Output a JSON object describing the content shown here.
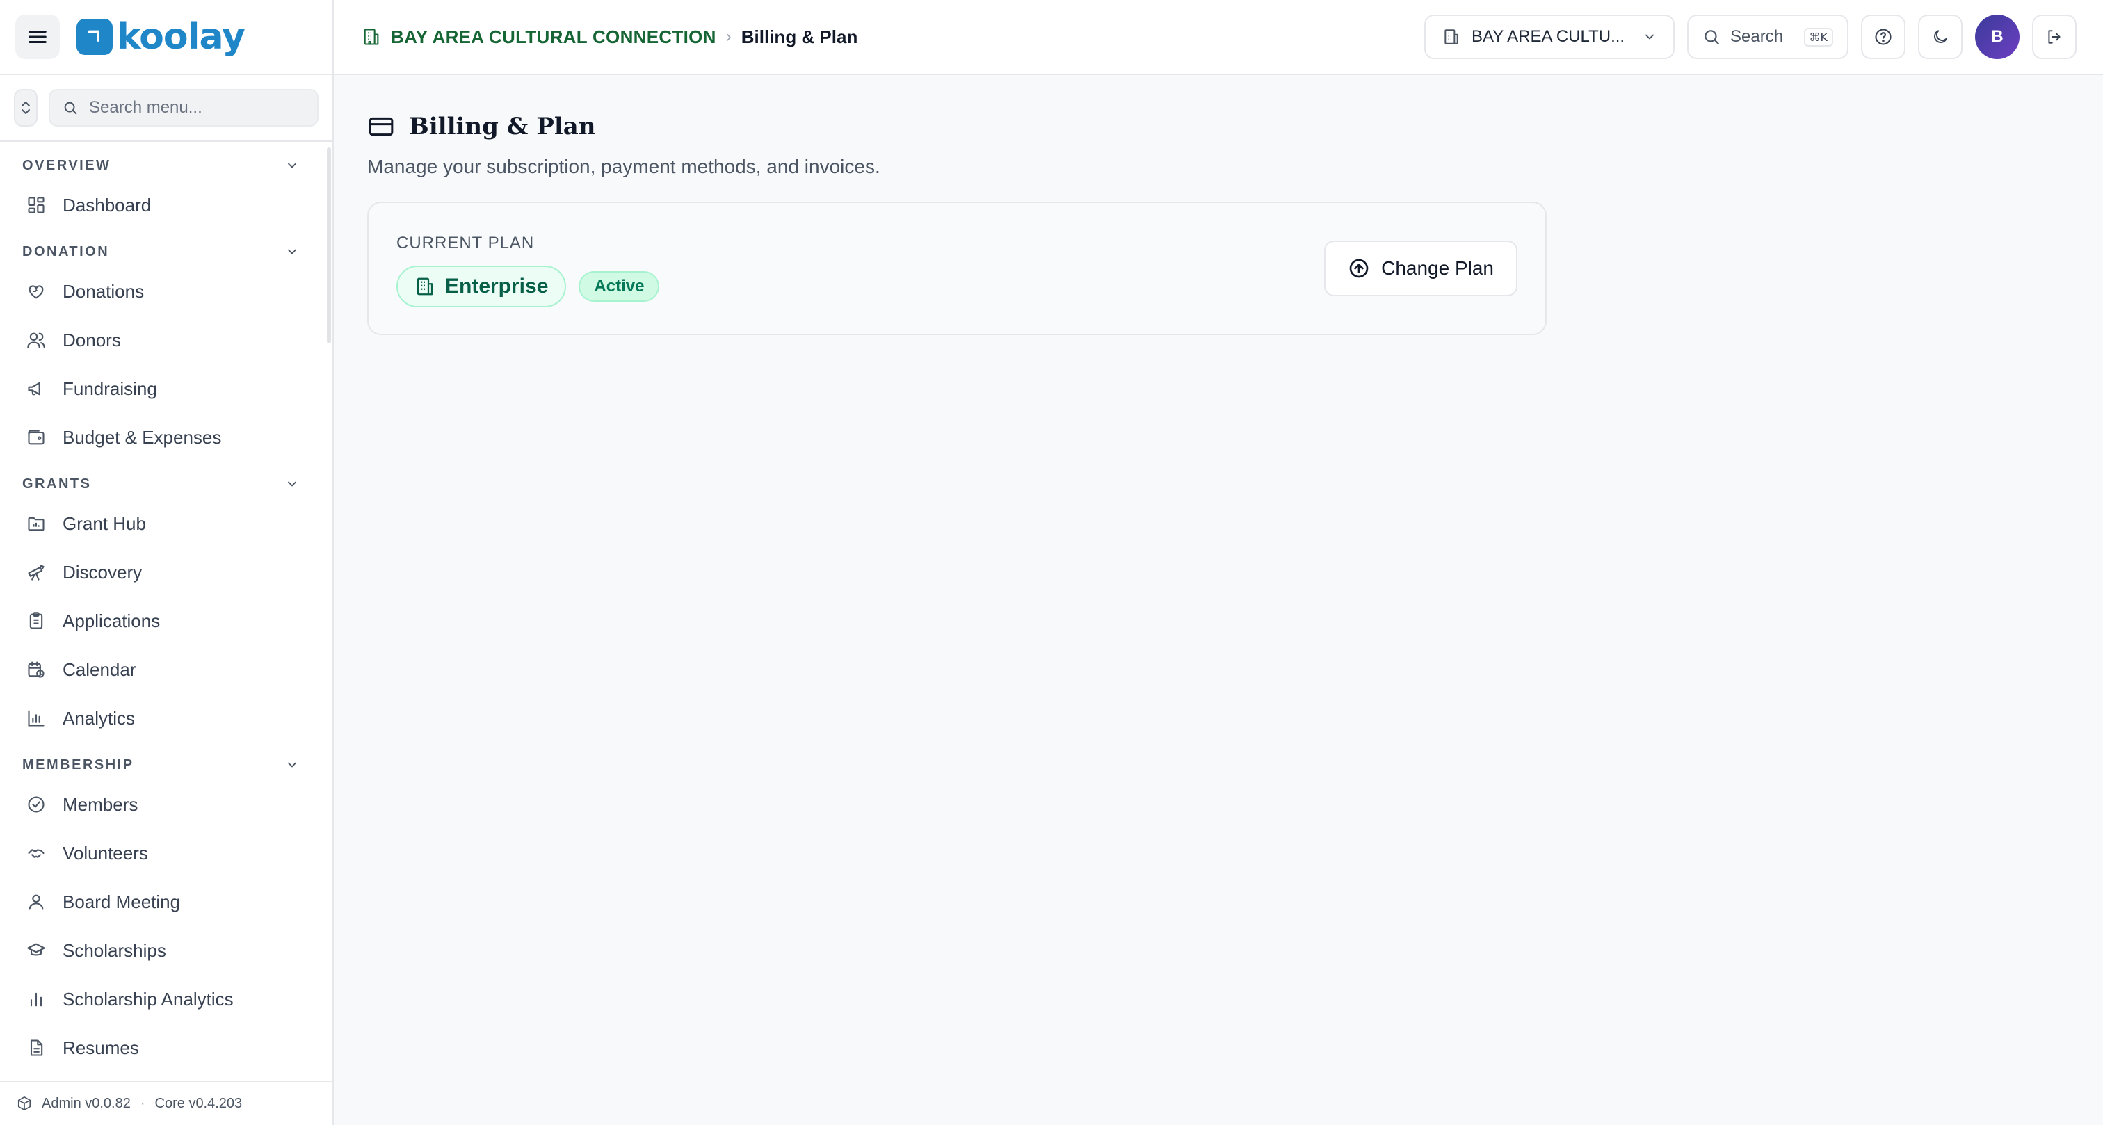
{
  "brand": {
    "name": "koolay",
    "color": "#1f86c7"
  },
  "sidebar": {
    "search_placeholder": "Search menu...",
    "sections": [
      {
        "title": "OVERVIEW",
        "items": [
          {
            "label": "Dashboard",
            "icon": "dashboard-icon"
          }
        ]
      },
      {
        "title": "DONATION",
        "items": [
          {
            "label": "Donations",
            "icon": "heart-hand-icon"
          },
          {
            "label": "Donors",
            "icon": "users-icon"
          },
          {
            "label": "Fundraising",
            "icon": "megaphone-icon"
          },
          {
            "label": "Budget & Expenses",
            "icon": "wallet-icon"
          }
        ]
      },
      {
        "title": "GRANTS",
        "items": [
          {
            "label": "Grant Hub",
            "icon": "folder-chart-icon"
          },
          {
            "label": "Discovery",
            "icon": "telescope-icon"
          },
          {
            "label": "Applications",
            "icon": "clipboard-icon"
          },
          {
            "label": "Calendar",
            "icon": "calendar-clock-icon"
          },
          {
            "label": "Analytics",
            "icon": "bar-chart-icon"
          }
        ]
      },
      {
        "title": "MEMBERSHIP",
        "items": [
          {
            "label": "Members",
            "icon": "check-circle-icon"
          },
          {
            "label": "Volunteers",
            "icon": "handshake-icon"
          },
          {
            "label": "Board Meeting",
            "icon": "user-icon"
          },
          {
            "label": "Scholarships",
            "icon": "graduation-cap-icon"
          },
          {
            "label": "Scholarship Analytics",
            "icon": "bar-chart-icon"
          },
          {
            "label": "Resumes",
            "icon": "file-text-icon"
          }
        ]
      }
    ],
    "footer": {
      "admin_version": "Admin v0.0.82",
      "separator": "·",
      "core_version": "Core v0.4.203"
    }
  },
  "header": {
    "breadcrumb": {
      "org": "BAY AREA CULTURAL CONNECTION",
      "separator": "›",
      "current": "Billing & Plan"
    },
    "org_select": "BAY AREA CULTU...",
    "search_label": "Search",
    "search_shortcut": "⌘K",
    "avatar_initial": "B"
  },
  "main": {
    "title": "Billing & Plan",
    "subtitle": "Manage your subscription, payment methods, and invoices.",
    "plan_card": {
      "label": "CURRENT PLAN",
      "plan_name": "Enterprise",
      "status": "Active",
      "change_button": "Change Plan"
    }
  },
  "colors": {
    "breadcrumb_org": "#166534",
    "plan_pill_bg": "#ecfdf5",
    "plan_pill_text": "#065f46",
    "status_bg": "#d1fae5",
    "status_text": "#047857"
  }
}
